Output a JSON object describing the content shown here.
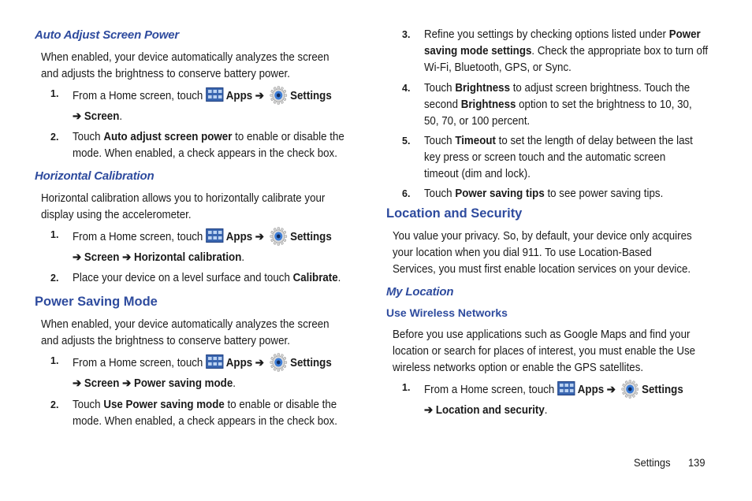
{
  "left": {
    "auto_adjust": {
      "heading": "Auto Adjust Screen Power",
      "intro": [
        "When enabled, your device automatically analyzes the screen",
        "and adjusts the brightness to conserve battery power."
      ],
      "steps": [
        {
          "num": "1.",
          "pre": "From a Home screen, touch",
          "apps": "Apps",
          "arrow": "➔",
          "settings": "Settings",
          "path": "➔ Screen",
          "end": "."
        },
        {
          "num": "2.",
          "lines": [
            [
              "Touch ",
              "Auto adjust screen power",
              " to enable or disable the"
            ],
            [
              "mode. When enabled, a check appears in the check box."
            ]
          ]
        }
      ]
    },
    "horizontal": {
      "heading": "Horizontal Calibration",
      "intro": [
        "Horizontal calibration allows you to horizontally calibrate your",
        "display using the accelerometer."
      ],
      "steps": [
        {
          "num": "1.",
          "pre": "From a Home screen, touch",
          "apps": "Apps",
          "arrow": "➔",
          "settings": "Settings",
          "path": "➔ Screen ➔ Horizontal calibration",
          "end": "."
        },
        {
          "num": "2.",
          "lines": [
            [
              "Place your device on a level surface and touch ",
              "Calibrate",
              "."
            ]
          ]
        }
      ]
    },
    "power_saving": {
      "heading": "Power Saving Mode",
      "intro": [
        "When enabled, your device automatically analyzes the screen",
        "and adjusts the brightness to conserve battery power."
      ],
      "steps": [
        {
          "num": "1.",
          "pre": "From a Home screen, touch",
          "apps": "Apps",
          "arrow": "➔",
          "settings": "Settings",
          "path": "➔ Screen ➔ Power saving mode",
          "end": "."
        },
        {
          "num": "2.",
          "lines": [
            [
              "Touch ",
              "Use Power saving mode",
              " to enable or disable the"
            ],
            [
              "mode. When enabled, a check appears in the check box."
            ]
          ]
        }
      ]
    }
  },
  "right": {
    "steps": [
      {
        "num": "3.",
        "lines": [
          [
            "Refine you settings by checking options listed under ",
            "Power",
            ""
          ],
          [
            "",
            "saving mode settings",
            ". Check the appropriate box to turn off"
          ],
          [
            "Wi-Fi, Bluetooth, GPS, or Sync."
          ]
        ]
      },
      {
        "num": "4.",
        "lines": [
          [
            "Touch ",
            "Brightness",
            " to adjust screen brightness. Touch the"
          ],
          [
            "second ",
            "Brightness",
            " option to set the brightness to 10, 30,"
          ],
          [
            "50, 70, or 100 percent."
          ]
        ]
      },
      {
        "num": "5.",
        "lines": [
          [
            "Touch ",
            "Timeout",
            " to set the length of delay between the last"
          ],
          [
            "key press or screen touch and the automatic screen"
          ],
          [
            "timeout (dim and lock)."
          ]
        ]
      },
      {
        "num": "6.",
        "lines": [
          [
            "Touch ",
            "Power saving tips",
            " to see power saving tips."
          ]
        ]
      }
    ],
    "location": {
      "heading": "Location and Security",
      "intro": [
        "You value your privacy. So, by default, your device only acquires",
        "your location when you dial 911. To use Location-Based",
        "Services, you must first enable location services on your device."
      ],
      "my_location": "My Location",
      "wireless_heading": "Use Wireless Networks",
      "wireless_intro": [
        "Before you use applications such as Google Maps and find your",
        "location or search for places of interest, you must enable the Use",
        "wireless networks option or enable the GPS satellites."
      ],
      "step": {
        "num": "1.",
        "pre": "From a Home screen, touch",
        "apps": "Apps",
        "arrow": "➔",
        "settings": "Settings",
        "path": "➔ Location and security",
        "end": "."
      }
    }
  },
  "footer": {
    "section": "Settings",
    "page": "139"
  }
}
